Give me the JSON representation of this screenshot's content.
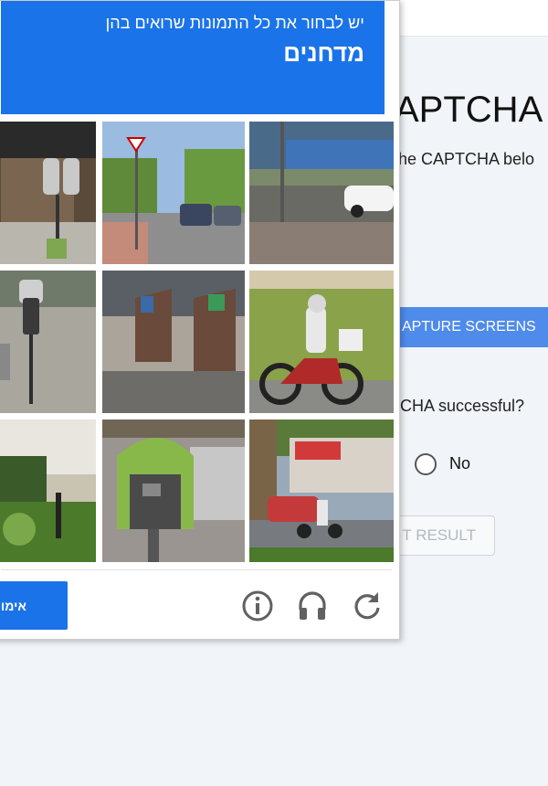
{
  "page": {
    "heading": "APTCHA",
    "instruction": "he CAPTCHA belo",
    "capture_button": "APTURE SCREENS",
    "question": "CHA successful?",
    "radio_no_label": "No",
    "submit_button": "T RESULT"
  },
  "captcha": {
    "instruction_line1": "יש לבחור את כל התמונות שרואים בהן",
    "target_word": "מדחנים",
    "verify_button": "אימות",
    "tiles": [
      {
        "row": 1,
        "col": 1,
        "subject": "parking meters on sidewalk"
      },
      {
        "row": 1,
        "col": 2,
        "subject": "street with cars"
      },
      {
        "row": 1,
        "col": 3,
        "subject": "road with white car"
      },
      {
        "row": 2,
        "col": 1,
        "subject": "parking meter"
      },
      {
        "row": 2,
        "col": 2,
        "subject": "waste bins"
      },
      {
        "row": 2,
        "col": 3,
        "subject": "motorcycle"
      },
      {
        "row": 3,
        "col": 1,
        "subject": "bushes and pole"
      },
      {
        "row": 3,
        "col": 2,
        "subject": "green telephone booth"
      },
      {
        "row": 3,
        "col": 3,
        "subject": "scooter on street"
      }
    ],
    "icons": [
      "info-icon",
      "headphones-icon",
      "reload-icon"
    ],
    "colors": {
      "header": "#1a73e8",
      "button": "#1a73e8"
    }
  }
}
